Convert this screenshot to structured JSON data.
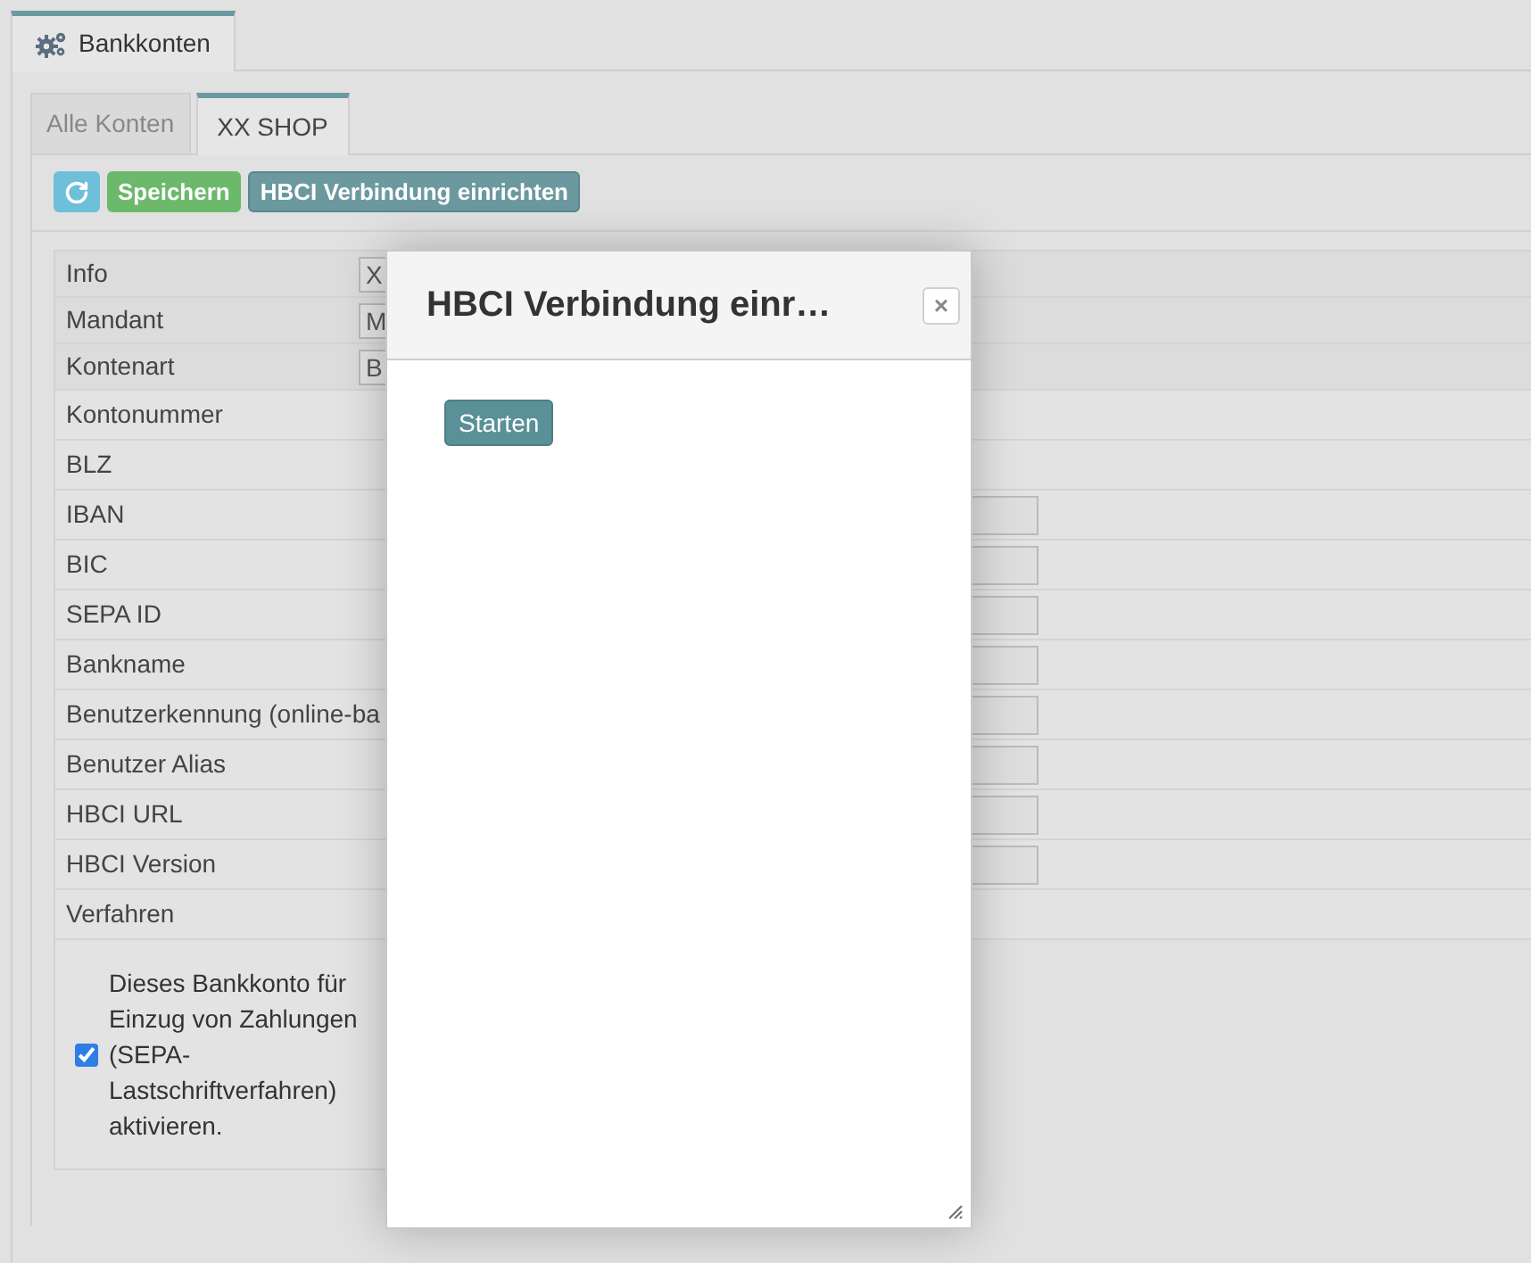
{
  "main_tab": {
    "label": "Bankkonten"
  },
  "tabs": [
    {
      "label": "Alle Konten",
      "selected": false
    },
    {
      "label": "XX SHOP",
      "selected": true
    }
  ],
  "toolbar": {
    "save": "Speichern",
    "hbci": "HBCI Verbindung einrichten"
  },
  "fields": [
    {
      "label": "Info",
      "kind": "header",
      "value": "X"
    },
    {
      "label": "Mandant",
      "kind": "header",
      "value": "M"
    },
    {
      "label": "Kontenart",
      "kind": "header",
      "value": "B"
    },
    {
      "label": "Kontonummer",
      "kind": "plain"
    },
    {
      "label": "BLZ",
      "kind": "plain"
    },
    {
      "label": "IBAN",
      "kind": "input"
    },
    {
      "label": "BIC",
      "kind": "input"
    },
    {
      "label": "SEPA ID",
      "kind": "input"
    },
    {
      "label": "Bankname",
      "kind": "input"
    },
    {
      "label": "Benutzerkennung (online-ba",
      "kind": "input"
    },
    {
      "label": "Benutzer Alias",
      "kind": "input"
    },
    {
      "label": "HBCI URL",
      "kind": "input"
    },
    {
      "label": "HBCI Version",
      "kind": "input"
    },
    {
      "label": "Verfahren",
      "kind": "plain"
    }
  ],
  "sepa": {
    "checked": true,
    "text": "Dieses Bankkonto für Einzug von Zahlungen (SEPA-Lastschriftverfahren) aktivieren."
  },
  "dialog": {
    "title": "HBCI Verbindung einr…",
    "close": "×",
    "start": "Starten"
  }
}
